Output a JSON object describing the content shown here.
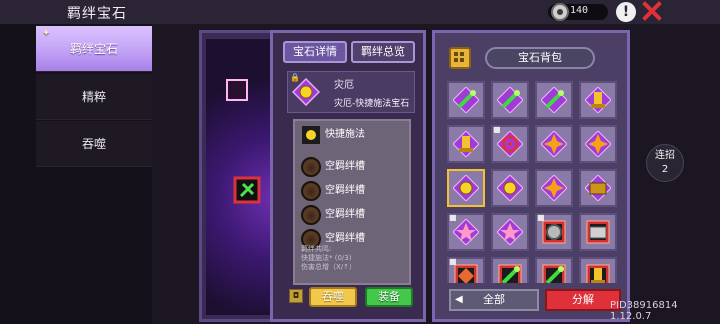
{
  "header": {
    "title": "羁绊宝石",
    "currency_value": "140",
    "info_icon": "exclamation-icon",
    "close_icon": "close-x-icon",
    "close_color": "#e0313b"
  },
  "sidebar": {
    "items": [
      {
        "label": "羁绊宝石",
        "active": true
      },
      {
        "label": "精粹",
        "active": false
      },
      {
        "label": "吞噬",
        "active": false
      }
    ],
    "active_color": "#c3a3f5"
  },
  "detail": {
    "tabs": [
      "宝石详情",
      "羁绊总览"
    ],
    "gem": {
      "name": "灾厄",
      "full_name": "灾厄-快捷施法宝石",
      "icon": "sun-gem-icon"
    },
    "skill": "快捷施法",
    "slots": [
      "空羁绊槽",
      "空羁绊槽",
      "空羁绊槽",
      "空羁绊槽"
    ],
    "stats": [
      "羁绊共鸣:",
      "快捷施法* (0/3)",
      "伤害总增（X/↑）"
    ],
    "buttons": {
      "devour": "吞噬",
      "equip": "装备"
    }
  },
  "backpack": {
    "title": "宝石背包",
    "filter_label": "全部",
    "split_label": "分解",
    "frame_colors": {
      "purple": "#a13bd8",
      "red": "#d2312f"
    },
    "items": [
      {
        "icon": "green-staff-gem-icon",
        "frame": "purple",
        "locked": false
      },
      {
        "icon": "green-staff-gem-icon",
        "frame": "purple",
        "locked": false
      },
      {
        "icon": "green-staff-gem-icon",
        "frame": "purple",
        "locked": false
      },
      {
        "icon": "gold-totem-gem-icon",
        "frame": "purple",
        "locked": false
      },
      {
        "icon": "gold-totem-gem-icon",
        "frame": "purple",
        "locked": false
      },
      {
        "icon": "red-swirl-gem-icon",
        "frame": "purple",
        "locked": true
      },
      {
        "icon": "burst-gem-icon",
        "frame": "purple",
        "locked": false
      },
      {
        "icon": "burst-gem-icon",
        "frame": "purple",
        "locked": false
      },
      {
        "icon": "sun-gem-icon",
        "frame": "purple",
        "locked": false,
        "selected": true
      },
      {
        "icon": "sun-gem-icon",
        "frame": "purple",
        "locked": false
      },
      {
        "icon": "burst-gem-icon",
        "frame": "purple",
        "locked": false
      },
      {
        "icon": "chest-gem-icon",
        "frame": "purple",
        "locked": false
      },
      {
        "icon": "pink-star-gem-icon",
        "frame": "purple",
        "locked": true
      },
      {
        "icon": "pink-star-gem-icon",
        "frame": "purple",
        "locked": false
      },
      {
        "icon": "grey-gear-gem-icon",
        "frame": "red",
        "locked": true
      },
      {
        "icon": "silver-chest-gem-icon",
        "frame": "red",
        "locked": false
      },
      {
        "icon": "red-stone-gem-icon",
        "frame": "red",
        "locked": true
      },
      {
        "icon": "green-staff-gem-icon",
        "frame": "red",
        "locked": false
      },
      {
        "icon": "green-staff-gem-icon",
        "frame": "red",
        "locked": false
      },
      {
        "icon": "gold-totem-gem-icon",
        "frame": "red",
        "locked": false
      }
    ]
  },
  "combo": {
    "label": "连招",
    "value": "2"
  },
  "footer": {
    "pid": "PID38916814 1.12.0.7"
  }
}
